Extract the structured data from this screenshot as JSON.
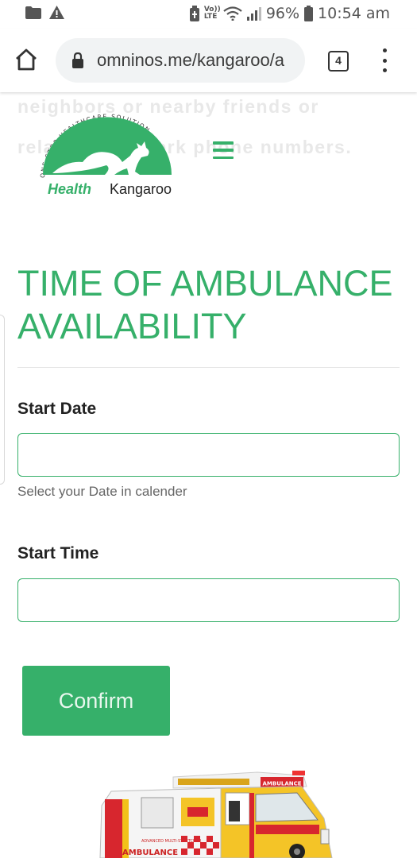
{
  "status_bar": {
    "time": "10:54 am",
    "battery": "96%",
    "volte": "Vo)) LTE",
    "icons": [
      "folder-icon",
      "warning-icon",
      "battery-saver-icon",
      "wifi-icon",
      "signal-icon",
      "battery-icon"
    ]
  },
  "browser": {
    "url": "omninos.me/kangaroo/a",
    "tab_count": "4"
  },
  "faded_text": {
    "line1": "neighbors or nearby friends or",
    "line2": "relatives network phone numbers."
  },
  "logo": {
    "arc_text": "ONE STOP HEALTHCARE SOLUTION",
    "word1": "Health",
    "word2": "Kangaroo",
    "brand_color": "#36b06a"
  },
  "page": {
    "title_line1": "TIME OF AMBULANCE",
    "title_line2": "AVAILABILITY"
  },
  "form": {
    "start_date_label": "Start Date",
    "start_date_value": "",
    "start_date_helper": "Select your Date in calender",
    "start_time_label": "Start Time",
    "start_time_value": "",
    "confirm_label": "Confirm"
  },
  "ambulance_image": {
    "roof_label": "AMBULANCE",
    "side_text": "ADVANCED MULTI-STRETCHER",
    "side_label": "AMBULANCE"
  },
  "colors": {
    "accent": "#36b06a",
    "text": "#222222"
  }
}
